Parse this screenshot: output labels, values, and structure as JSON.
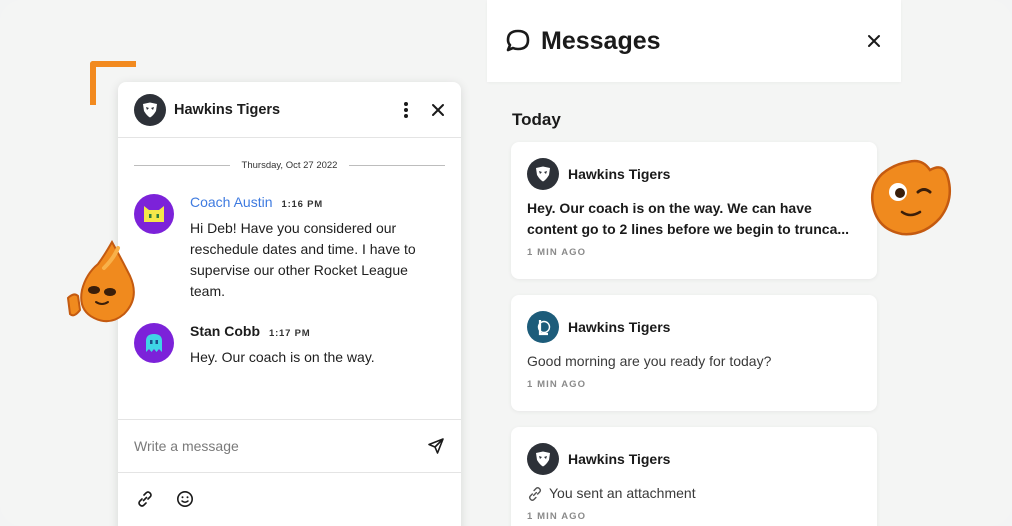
{
  "chat": {
    "title": "Hawkins Tigers",
    "date_divider": "Thursday, Oct 27 2022",
    "messages": [
      {
        "sender": "Coach Austin",
        "time": "1:16 PM",
        "text": "Hi Deb! Have you considered our reschedule dates and time. I have to supervise our other Rocket League team."
      },
      {
        "sender": "Stan Cobb",
        "time": "1:17 PM",
        "text": "Hey. Our coach is on the way."
      }
    ],
    "composer": {
      "placeholder": "Write a message"
    }
  },
  "panel": {
    "title": "Messages",
    "section": "Today",
    "conversations": [
      {
        "title": "Hawkins Tigers",
        "preview": "Hey. Our coach is on the way. We can have content go to 2 lines before we begin to trunca...",
        "time": "1 MIN AGO",
        "unread": true,
        "avatar_icon": "tiger-shield-icon"
      },
      {
        "title": "Hawkins Tigers",
        "preview": "Good morning are you ready for today?",
        "time": "1 MIN AGO",
        "unread": false,
        "avatar_icon": "league-logo-icon"
      },
      {
        "title": "Hawkins Tigers",
        "preview": "You sent an attachment",
        "time": "1 MIN AGO",
        "unread": false,
        "avatar_icon": "tiger-shield-icon"
      }
    ]
  },
  "colors": {
    "accent_orange": "#f28a1f",
    "coach_name": "#3f7be0",
    "avatar_purple": "#7c22d9",
    "team_avatar": "#2d3138"
  }
}
